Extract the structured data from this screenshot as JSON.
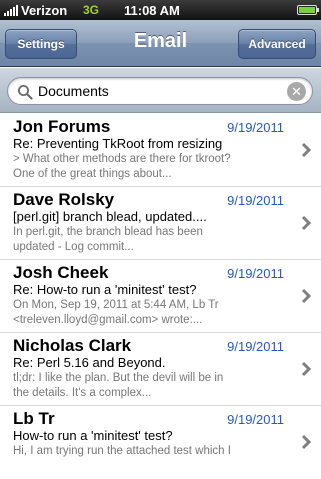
{
  "status_bar": {
    "carrier": "Verizon",
    "network": "3G",
    "time": "11:08 AM"
  },
  "nav": {
    "left_button": "Settings",
    "title": "Email",
    "right_button": "Advanced"
  },
  "search": {
    "value": "Documents"
  },
  "colors": {
    "date": "#2359c3",
    "preview": "#777777"
  },
  "emails": [
    {
      "sender": "Jon Forums",
      "date": "9/19/2011",
      "subject": "Re: Preventing TkRoot from resizing",
      "preview_line1": "> What other methods are there for tkroot?",
      "preview_line2": "One of the great things about..."
    },
    {
      "sender": "Dave Rolsky",
      "date": "9/19/2011",
      "subject": "[perl.git]  branch blead, updated....",
      "preview_line1": "In perl.git, the branch blead has been",
      "preview_line2": "updated  - Log  commit..."
    },
    {
      "sender": "Josh Cheek",
      "date": "9/19/2011",
      "subject": "Re: How-to run a 'minitest' test?",
      "preview_line1": "On Mon, Sep 19, 2011 at 5:44 AM, Lb Tr",
      "preview_line2": "<treleven.lloyd@gmail.com> wrote:..."
    },
    {
      "sender": "Nicholas Clark",
      "date": "9/19/2011",
      "subject": "Re: Perl 5.16 and Beyond.",
      "preview_line1": "tl;dr: I like the plan. But the devil will be in",
      "preview_line2": "the details. It's a complex..."
    },
    {
      "sender": "Lb Tr",
      "date": "9/19/2011",
      "subject": "How-to run a 'minitest' test?",
      "preview_line1": "Hi, I am trying run the attached test which I",
      "preview_line2": ""
    }
  ]
}
